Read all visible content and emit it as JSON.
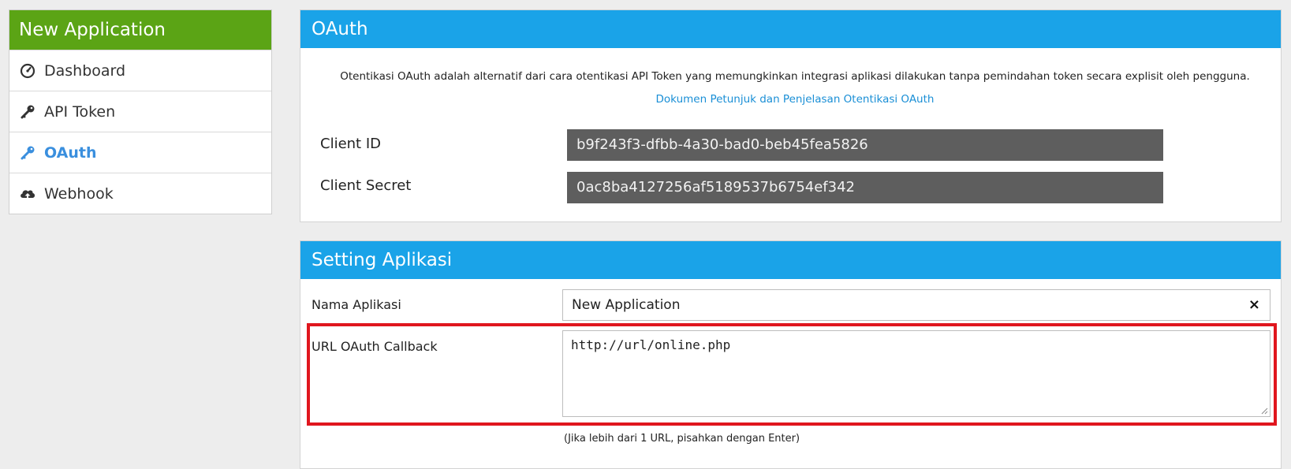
{
  "sidebar": {
    "title": "New Application",
    "items": [
      {
        "label": "Dashboard",
        "icon": "dashboard-icon"
      },
      {
        "label": "API Token",
        "icon": "key-icon"
      },
      {
        "label": "OAuth",
        "icon": "key-icon",
        "active": true
      },
      {
        "label": "Webhook",
        "icon": "cloud-upload-icon"
      }
    ]
  },
  "oauth": {
    "title": "OAuth",
    "description": "Otentikasi OAuth adalah alternatif dari cara otentikasi API Token yang memungkinkan integrasi aplikasi dilakukan tanpa pemindahan token secara explisit oleh pengguna.",
    "doc_link": "Dokumen Petunjuk dan Penjelasan Otentikasi OAuth",
    "client_id_label": "Client ID",
    "client_id_value": "b9f243f3-dfbb-4a30-bad0-beb45fea5826",
    "client_secret_label": "Client Secret",
    "client_secret_value": "0ac8ba4127256af5189537b6754ef342"
  },
  "settings": {
    "title": "Setting Aplikasi",
    "app_name_label": "Nama Aplikasi",
    "app_name_value": "New Application",
    "clear_symbol": "×",
    "callback_label": "URL OAuth Callback",
    "callback_value": "http://url/online.php",
    "callback_hint": "(Jika lebih dari 1 URL, pisahkan dengan Enter)"
  },
  "colors": {
    "sidebar_header": "#5ba415",
    "panel_header": "#1aa3e8",
    "active_link": "#3a8fde",
    "highlight": "#e0161e"
  }
}
